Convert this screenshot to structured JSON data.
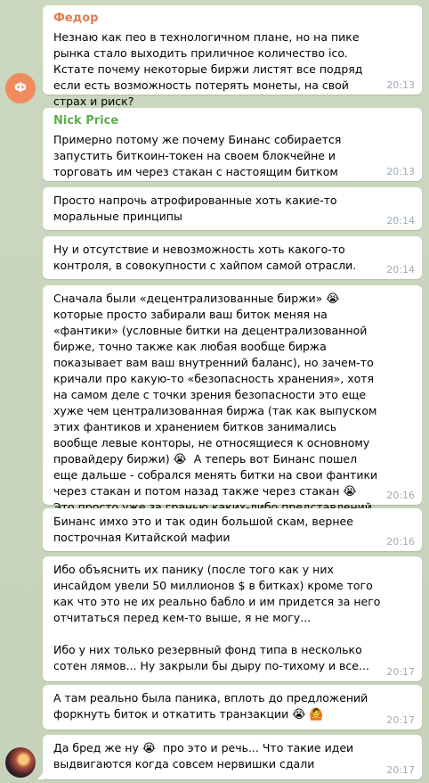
{
  "messages": [
    {
      "sender": "Федор",
      "sender_color": "#e17d52",
      "text": "Незнаю как пео в технологичном плане, но на пике рынка стало выходить приличное количество ico. Кстате почему некоторые биржи листят все подряд если есть возможность потерять монеты, на свой страх и риск?",
      "time": "20:13"
    },
    {
      "sender": "Nick Price",
      "sender_color": "#5fae4d",
      "text": "Примерно потому же почему Бинанс собирается запустить биткоин-токен на своем блокчейне и торговать им через стакан с настоящим битком",
      "time": "20:13"
    },
    {
      "text": "Просто напрочь атрофированные хоть какие-то моральные принципы",
      "time": "20:14"
    },
    {
      "text": "Ну и отсутствие и невозможность хоть какого-то контроля, в совокупности с хайпом самой отрасли.",
      "time": "20:14"
    },
    {
      "text_parts": [
        "Сначала были «децентрализованные биржи» ",
        " которые просто забирали ваш биток меняя на «фантики» (условные битки на децентрализованной бирже, точно также как любая вообще биржа показывает вам ваш внутренний баланс), но зачем-то кричали про какую-то «безопасность хранения», хотя на самом деле с точки зрения безопасности это еще хуже чем централизованная биржа (так как выпуском этих фантиков и хранением битков занимались вообще левые конторы, не относящиеся к основному провайдеру биржи) ",
        "  А теперь вот Бинанс пошел еще дальше - собрался менять битки на свои фантики через стакан и потом назад также через стакан ",
        "  Это просто уже за гранью каких-либо представлений о добре и зле..."
      ],
      "emoji": "😭",
      "time": "20:16"
    },
    {
      "text": "Бинанс имхо это и так один большой скам, вернее построчная Китайской мафии",
      "time": "20:16"
    },
    {
      "text": "Ибо объяснить их панику (после того как у них инсайдом увели 50 миллионов $ в битках) кроме того как что это не их реально бабло и им придется за него отчитаться перед кем-то выше, я не могу...\n\nИбо у них только резервный фонд типа в несколько сотен лямов... Ну закрыли бы дыру по-тихому и все...",
      "time": "20:17"
    },
    {
      "text": "А там реально была паника, вплоть до предложений форкнуть биток и откатить транзакции ",
      "emoji": "😭",
      "emoji2": "🙆",
      "time": "20:17"
    },
    {
      "text_parts": [
        "Да бред же ну ",
        "  про это и речь... Что такие идеи выдвигаются когда совсем нервишки сдали"
      ],
      "emoji": "😭",
      "time": "20:17"
    }
  ],
  "avatars": {
    "fedor_letter": "Ф"
  }
}
